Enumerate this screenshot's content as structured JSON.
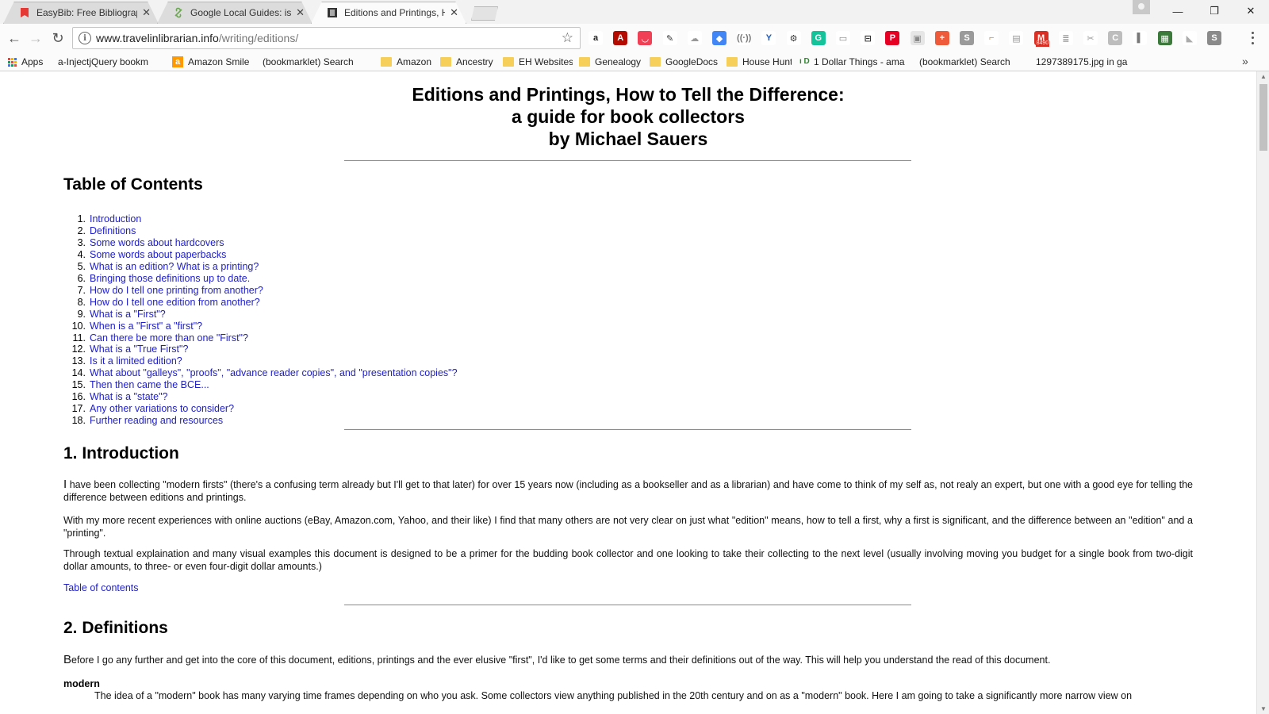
{
  "browser": {
    "tabs": [
      {
        "title": "EasyBib: Free Bibliograph",
        "active": false
      },
      {
        "title": "Google Local Guides: is t",
        "active": false
      },
      {
        "title": "Editions and Printings, H",
        "active": true
      }
    ],
    "close_glyph": "✕",
    "window_controls": {
      "minimize": "—",
      "restore": "❐",
      "close": "✕"
    },
    "nav": {
      "back": "←",
      "forward": "→",
      "reload": "↻"
    },
    "address": {
      "host": "www.travelinlibrarian.info",
      "path": "/writing/editions/",
      "star": "☆"
    },
    "extensions": [
      {
        "name": "amazon-icon",
        "color": "#ffffff",
        "fg": "#222222",
        "glyph": "a"
      },
      {
        "name": "acrobat-icon",
        "color": "#b30b00",
        "fg": "#ffffff",
        "glyph": "A"
      },
      {
        "name": "pocket-icon",
        "color": "#ef4056",
        "fg": "#ffffff",
        "glyph": "◡"
      },
      {
        "name": "eyedropper-icon",
        "color": "#ffffff",
        "fg": "#333333",
        "glyph": "✎"
      },
      {
        "name": "cloud-icon",
        "color": "#ffffff",
        "fg": "#999999",
        "glyph": "☁"
      },
      {
        "name": "google-drive-icon",
        "color": "#4285f4",
        "fg": "#ffffff",
        "glyph": "◆"
      },
      {
        "name": "broadcast-icon",
        "color": "#ffffff",
        "fg": "#777777",
        "glyph": "((·))"
      },
      {
        "name": "y-icon",
        "color": "#ffffff",
        "fg": "#1e5bb8",
        "glyph": "Y"
      },
      {
        "name": "gear-icon",
        "color": "#ffffff",
        "fg": "#333333",
        "glyph": "⚙"
      },
      {
        "name": "grammarly-icon",
        "color": "#15c39a",
        "fg": "#ffffff",
        "glyph": "G"
      },
      {
        "name": "card-icon",
        "color": "#ffffff",
        "fg": "#888888",
        "glyph": "▭"
      },
      {
        "name": "car-icon",
        "color": "#ffffff",
        "fg": "#333333",
        "glyph": "⊟"
      },
      {
        "name": "pinterest-icon",
        "color": "#e60023",
        "fg": "#ffffff",
        "glyph": "P"
      },
      {
        "name": "page-icon",
        "color": "#e6e6e6",
        "fg": "#888888",
        "glyph": "▣"
      },
      {
        "name": "plus-icon",
        "color": "#ef5a3a",
        "fg": "#ffffff",
        "glyph": "+"
      },
      {
        "name": "s-icon",
        "color": "#9a9a9a",
        "fg": "#ffffff",
        "glyph": "S"
      },
      {
        "name": "hammer-icon",
        "color": "#ffffff",
        "fg": "#e08a1e",
        "glyph": "⌐"
      },
      {
        "name": "reader-icon",
        "color": "#ffffff",
        "fg": "#999999",
        "glyph": "▤"
      },
      {
        "name": "gmail-icon",
        "color": "#d93025",
        "fg": "#ffffff",
        "glyph": "M"
      },
      {
        "name": "doc-icon",
        "color": "#ffffff",
        "fg": "#999999",
        "glyph": "≣"
      },
      {
        "name": "x-tool-icon",
        "color": "#ffffff",
        "fg": "#999999",
        "glyph": "✂"
      },
      {
        "name": "c-icon",
        "color": "#bdbdbd",
        "fg": "#ffffff",
        "glyph": "C"
      },
      {
        "name": "panel-icon",
        "color": "#ffffff",
        "fg": "#777777",
        "glyph": "▌"
      },
      {
        "name": "image-icon",
        "color": "#3c7a3c",
        "fg": "#ffffff",
        "glyph": "▦"
      },
      {
        "name": "tag-icon",
        "color": "#ffffff",
        "fg": "#aaaaaa",
        "glyph": "◣"
      },
      {
        "name": "s-gray-icon",
        "color": "#8a8a8a",
        "fg": "#ffffff",
        "glyph": "S"
      }
    ],
    "gmail_badge": "8490",
    "bookmarks": [
      {
        "label": "Apps",
        "icon": "apps"
      },
      {
        "label": "a-InjectjQuery bookm",
        "icon": "page"
      },
      {
        "label": "Amazon Smile",
        "icon": "amazon"
      },
      {
        "label": "(bookmarklet) Search",
        "icon": "page"
      },
      {
        "label": "Amazon",
        "icon": "folder"
      },
      {
        "label": "Ancestry",
        "icon": "folder"
      },
      {
        "label": "EH Websites",
        "icon": "folder"
      },
      {
        "label": "Genealogy",
        "icon": "folder"
      },
      {
        "label": "GoogleDocs",
        "icon": "folder"
      },
      {
        "label": "House Hunt",
        "icon": "folder"
      },
      {
        "label": "1 Dollar Things - ama",
        "icon": "dollar"
      },
      {
        "label": "(bookmarklet) Search",
        "icon": "page"
      },
      {
        "label": "1297389175.jpg in ga",
        "icon": "page"
      }
    ],
    "bookmarks_overflow": "»"
  },
  "doc": {
    "title_line1": "Editions and Printings, How to Tell the Difference:",
    "title_line2": "a guide for book collectors",
    "title_line3": "by Michael Sauers",
    "toc_heading": "Table of Contents",
    "toc": [
      {
        "num": "1.",
        "label": "Introduction"
      },
      {
        "num": "2.",
        "label": "Definitions"
      },
      {
        "num": "3.",
        "label": "Some words about hardcovers"
      },
      {
        "num": "4.",
        "label": "Some words about paperbacks"
      },
      {
        "num": "5.",
        "label": "What is an edition? What is a printing?"
      },
      {
        "num": "6.",
        "label": "Bringing those definitions up to date."
      },
      {
        "num": "7.",
        "label": "How do I tell one printing from another?"
      },
      {
        "num": "8.",
        "label": "How do I tell one edition from another?"
      },
      {
        "num": "9.",
        "label": "What is a \"First\"?"
      },
      {
        "num": "10.",
        "label": "When is a \"First\" a \"first\"?"
      },
      {
        "num": "11.",
        "label": "Can there be more than one \"First\"?"
      },
      {
        "num": "12.",
        "label": "What is a \"True First\"?"
      },
      {
        "num": "13.",
        "label": "Is it a limited edition?"
      },
      {
        "num": "14.",
        "label": "What about \"galleys\", \"proofs\", \"advance reader copies\", and \"presentation copies\"?"
      },
      {
        "num": "15.",
        "label": "Then then came the BCE..."
      },
      {
        "num": "16.",
        "label": "What is a \"state\"?"
      },
      {
        "num": "17.",
        "label": "Any other variations to consider?"
      },
      {
        "num": "18.",
        "label": "Further reading and resources"
      }
    ],
    "intro_heading": "1. Introduction",
    "intro_p1_cap": "I",
    "intro_p1": " have been collecting \"modern firsts\" (there's a confusing term already but I'll get to that later) for over 15 years now (including as a bookseller and as a librarian) and have come to think of my self as, not realy an expert, but one with a good eye for telling the difference between editions and printings.",
    "intro_p2": "With my more recent experiences with online auctions (eBay, Amazon.com, Yahoo, and their like) I find that many others are not very clear on just what \"edition\" means, how to tell a first, why a first is significant, and the difference between an \"edition\" and a \"printing\".",
    "intro_p3": "Through textual explaination and many visual examples this document is designed to be a primer for the budding book collector and one looking to take their collecting to the next level (usually involving moving you budget for a single book from two-digit dollar amounts, to three- or even four-digit dollar amounts.)",
    "toc_link": "Table of contents",
    "defs_heading": "2. Definitions",
    "defs_p1_cap": "B",
    "defs_p1": "efore I go any further and get into the core of this document, editions, printings and the ever elusive \"first\", I'd like to get some terms and their definitions out of the way. This will help you understand the read of this document.",
    "term_modern": "modern",
    "term_modern_def": "The idea of a \"modern\" book has many varying time frames depending on who you ask. Some collectors view anything published in the 20th century and on as a \"modern\" book. Here I am going to take a significantly more narrow view on"
  }
}
